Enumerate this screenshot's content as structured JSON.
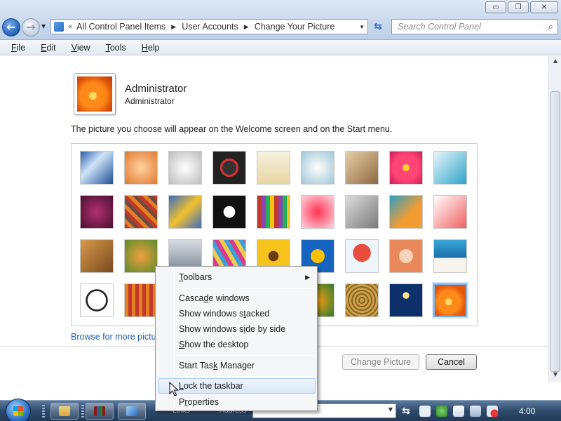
{
  "window": {
    "buttons": {
      "minimize": "▭",
      "maximize": "❐",
      "close": "✕"
    }
  },
  "address": {
    "chevron": "«",
    "crumbs": [
      "All Control Panel Items",
      "User Accounts",
      "Change Your Picture"
    ]
  },
  "search": {
    "placeholder": "Search Control Panel"
  },
  "menubar": {
    "items": [
      {
        "label": "File",
        "mnemonic": "F",
        "rest": "ile"
      },
      {
        "label": "Edit",
        "mnemonic": "E",
        "rest": "dit"
      },
      {
        "label": "View",
        "mnemonic": "V",
        "rest": "iew"
      },
      {
        "label": "Tools",
        "mnemonic": "T",
        "rest": "ools"
      },
      {
        "label": "Help",
        "mnemonic": "H",
        "rest": "elp"
      }
    ]
  },
  "user": {
    "name": "Administrator",
    "role": "Administrator"
  },
  "intro": "The picture you choose will appear on the Welcome screen and on the Start menu.",
  "pictures": {
    "selected_index": 35,
    "tiles": [
      "ferris-wheel",
      "starfish",
      "robot-figure",
      "record-player",
      "lucky-cat",
      "gyroscope",
      "kitten",
      "pink-flower",
      "pinwheel",
      "ball",
      "fabric",
      "yellow-leaf",
      "dog",
      "crayons",
      "red-star",
      "jacks",
      "stairs",
      "paper-crane",
      "guitar",
      "puppy",
      "robot-toy",
      "scarves",
      "sunflower",
      "fish",
      "hot-air-balloon",
      "doll",
      "sailboat",
      "soccer-ball",
      "red-fabric",
      "",
      "",
      "",
      "flowers",
      "basket",
      "lighthouse",
      "orange-flower"
    ]
  },
  "browse_link": "Browse for more pictur",
  "buttons": {
    "change_picture": "Change Picture",
    "cancel": "Cancel"
  },
  "context_menu": {
    "toolbars": {
      "pre": "",
      "mn": "T",
      "post": "oolbars"
    },
    "cascade": {
      "pre": "Casca",
      "mn": "d",
      "post": "e windows"
    },
    "stacked": {
      "pre": "Show windows s",
      "mn": "t",
      "post": "acked"
    },
    "side": {
      "pre": "Show windows s",
      "mn": "i",
      "post": "de by side"
    },
    "desktop": {
      "pre": "",
      "mn": "S",
      "post": "how the desktop"
    },
    "task_manager": {
      "pre": "Start Tas",
      "mn": "k",
      "post": " Manager"
    },
    "lock": {
      "pre": "",
      "mn": "L",
      "post": "ock the taskbar"
    },
    "properties": {
      "pre": "P",
      "mn": "r",
      "post": "operties"
    }
  },
  "taskbar": {
    "links_label": "Links",
    "address_label": "Address",
    "clock": "4:00"
  }
}
